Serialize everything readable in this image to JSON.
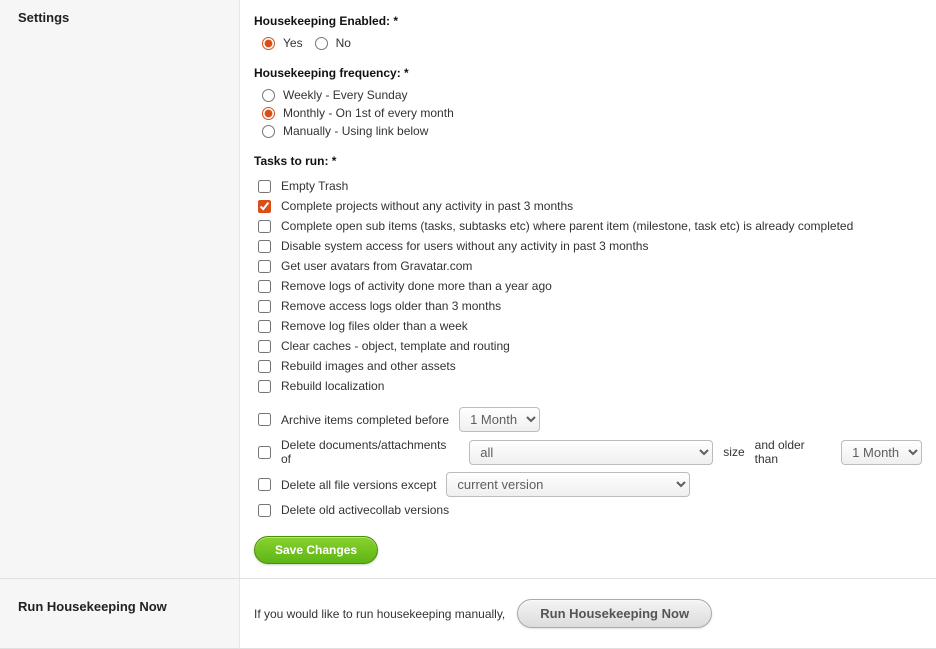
{
  "sections": {
    "settings_title": "Settings",
    "run_title": "Run Housekeeping Now"
  },
  "enabled": {
    "label": "Housekeeping Enabled: *",
    "yes": "Yes",
    "no": "No",
    "value": "yes"
  },
  "frequency": {
    "label": "Housekeeping frequency: *",
    "options": {
      "weekly": "Weekly - Every Sunday",
      "monthly": "Monthly - On 1st of every month",
      "manual": "Manually - Using link below"
    },
    "value": "monthly"
  },
  "tasks": {
    "label": "Tasks to run: *",
    "items": [
      {
        "label": "Empty Trash",
        "checked": false
      },
      {
        "label": "Complete projects without any activity in past 3 months",
        "checked": true
      },
      {
        "label": "Complete open sub items (tasks, subtasks etc) where parent item (milestone, task etc) is already completed",
        "checked": false
      },
      {
        "label": "Disable system access for users without any activity in past 3 months",
        "checked": false
      },
      {
        "label": "Get user avatars from Gravatar.com",
        "checked": false
      },
      {
        "label": "Remove logs of activity done more than a year ago",
        "checked": false
      },
      {
        "label": "Remove access logs older than 3 months",
        "checked": false
      },
      {
        "label": "Remove log files older than a week",
        "checked": false
      },
      {
        "label": "Clear caches - object, template and routing",
        "checked": false
      },
      {
        "label": "Rebuild images and other assets",
        "checked": false
      },
      {
        "label": "Rebuild localization",
        "checked": false
      }
    ]
  },
  "archive": {
    "label": "Archive items completed before",
    "select_value": "1 Month",
    "checked": false
  },
  "delete_docs": {
    "label": "Delete documents/attachments of",
    "size_select": "all",
    "mid_text_1": "size",
    "mid_text_2": "and older than",
    "age_select": "1 Month",
    "checked": false
  },
  "file_versions": {
    "label": "Delete all file versions except",
    "select_value": "current version",
    "checked": false
  },
  "delete_old_ac": {
    "label": "Delete old activecollab versions",
    "checked": false
  },
  "buttons": {
    "save": "Save Changes",
    "run": "Run Housekeeping Now"
  },
  "run_section": {
    "prompt": "If you would like to run housekeeping manually,"
  }
}
